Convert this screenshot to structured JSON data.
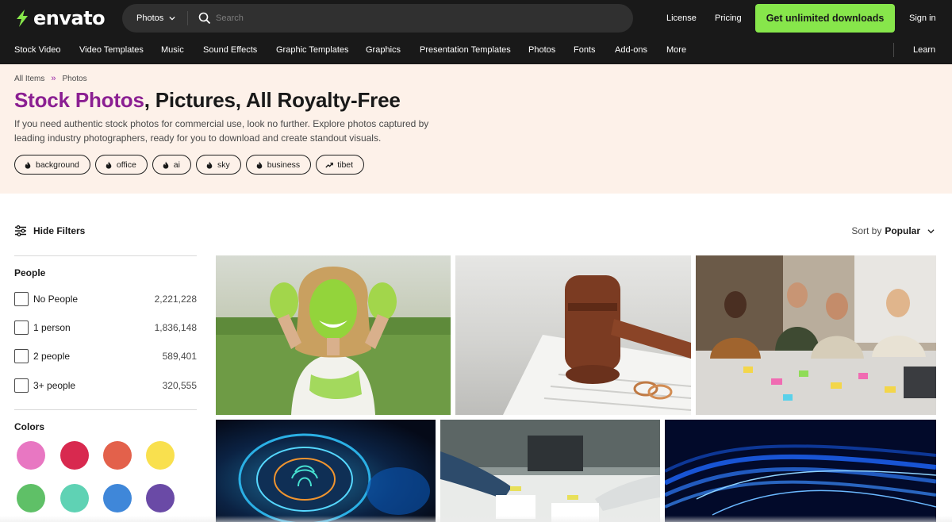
{
  "header": {
    "logo_text": "envato",
    "search": {
      "category": "Photos",
      "placeholder": "Search"
    },
    "links": {
      "license": "License",
      "pricing": "Pricing",
      "sign_in": "Sign in"
    },
    "cta_label": "Get unlimited downloads"
  },
  "nav": {
    "categories": [
      "Stock Video",
      "Video Templates",
      "Music",
      "Sound Effects",
      "Graphic Templates",
      "Graphics",
      "Presentation Templates",
      "Photos",
      "Fonts",
      "Add-ons",
      "More"
    ],
    "learn": "Learn"
  },
  "hero": {
    "breadcrumb": [
      "All Items",
      "Photos"
    ],
    "breadcrumb_sep": "»",
    "title_accent": "Stock Photos",
    "title_rest": ", Pictures, All Royalty-Free",
    "description": "If you need authentic stock photos for commercial use, look no further. Explore photos captured by leading industry photographers, ready for you to download and create standout visuals.",
    "tags": [
      {
        "label": "background",
        "icon": "flame-icon"
      },
      {
        "label": "office",
        "icon": "flame-icon"
      },
      {
        "label": "ai",
        "icon": "flame-icon"
      },
      {
        "label": "sky",
        "icon": "flame-icon"
      },
      {
        "label": "business",
        "icon": "flame-icon"
      },
      {
        "label": "tibet",
        "icon": "trending-up-icon"
      }
    ]
  },
  "toolbar": {
    "hide_filters": "Hide Filters",
    "sort_prefix": "Sort by",
    "sort_value": "Popular"
  },
  "filters": {
    "people": {
      "title": "People",
      "options": [
        {
          "label": "No People",
          "count": "2,221,228"
        },
        {
          "label": "1 person",
          "count": "1,836,148"
        },
        {
          "label": "2 people",
          "count": "589,401"
        },
        {
          "label": "3+ people",
          "count": "320,555"
        }
      ]
    },
    "colors": {
      "title": "Colors",
      "swatches": [
        "#e877c2",
        "#d8294f",
        "#e3614b",
        "#f9e04e",
        "#5fc067",
        "#5fd2b4",
        "#3f87d9",
        "#6a4aa6"
      ]
    }
  },
  "gallery": {
    "items": [
      {
        "subject": "woman with green holi paint"
      },
      {
        "subject": "judge gavel with wedding rings"
      },
      {
        "subject": "team meeting with sticky notes"
      },
      {
        "subject": "glowing fingerprint interface"
      },
      {
        "subject": "people working with charts"
      },
      {
        "subject": "blue light particle waves"
      }
    ]
  }
}
